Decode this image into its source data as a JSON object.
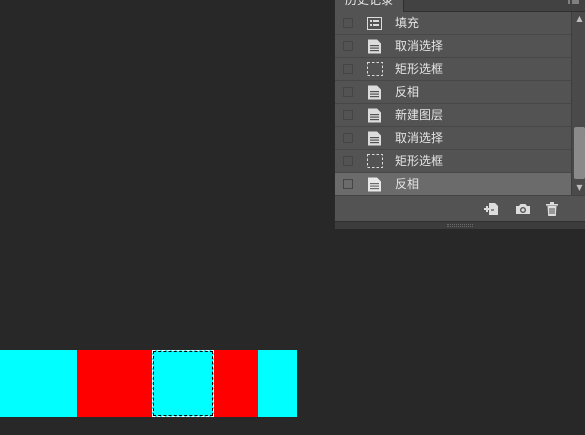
{
  "canvas": {
    "colors": {
      "cyan": "#00FFFF",
      "red": "#FF0000",
      "background": "#282828"
    }
  },
  "history_panel": {
    "tab_title": "历史记录",
    "menu_icon": "panel-menu-icon",
    "items": [
      {
        "label": "填充",
        "icon": "fill-icon"
      },
      {
        "label": "取消选择",
        "icon": "document-icon"
      },
      {
        "label": "矩形选框",
        "icon": "marquee-icon"
      },
      {
        "label": "反相",
        "icon": "document-icon"
      },
      {
        "label": "新建图层",
        "icon": "document-icon"
      },
      {
        "label": "取消选择",
        "icon": "document-icon"
      },
      {
        "label": "矩形选框",
        "icon": "marquee-icon"
      },
      {
        "label": "反相",
        "icon": "document-icon",
        "active": true
      }
    ],
    "footer_buttons": [
      "new-document-from-state-icon",
      "snapshot-camera-icon",
      "trash-icon"
    ]
  }
}
